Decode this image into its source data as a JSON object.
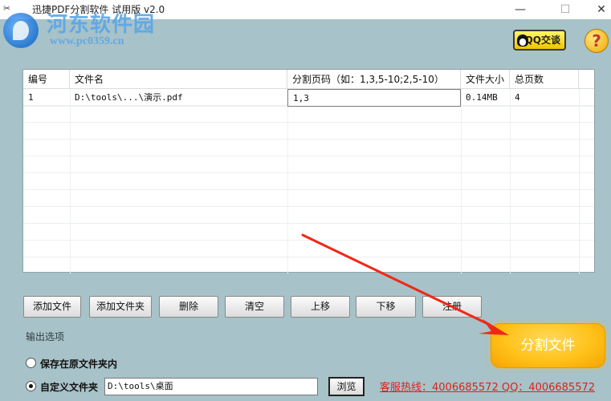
{
  "window": {
    "title": "迅捷PDF分割软件 试用版 v2.0",
    "min_glyph": "—",
    "max_glyph": "☐",
    "close_glyph": "✕"
  },
  "watermark": {
    "title": "河东软件园",
    "url": "www.pc0359.cn"
  },
  "header": {
    "qq_label": "QQ交谈",
    "help_glyph": "?"
  },
  "table": {
    "columns": [
      "编号",
      "文件名",
      "分割页码（如：1,3,5-10;2,5-10）",
      "文件大小",
      "总页数"
    ],
    "rows": [
      {
        "index": "1",
        "file": "D:\\tools\\...\\演示.pdf",
        "pages": "1,3",
        "size": "0.14MB",
        "total": "4"
      }
    ]
  },
  "buttons": {
    "add_file": "添加文件",
    "add_folder": "添加文件夹",
    "delete": "删除",
    "clear": "清空",
    "move_up": "上移",
    "move_down": "下移",
    "register": "注册"
  },
  "output": {
    "section_title": "输出选项",
    "option_same_folder": "保存在原文件夹内",
    "option_custom_folder": "自定义文件夹",
    "selected_option": "custom",
    "custom_path": "D:\\tools\\桌面",
    "browse": "浏览"
  },
  "hotline": "客服热线：4006685572 QQ：4006685572",
  "split_button": "分割文件",
  "colors": {
    "accent": "#ffc21a",
    "background": "#a7c2c8",
    "hotline": "#e0201c",
    "arrow": "#f02818"
  }
}
